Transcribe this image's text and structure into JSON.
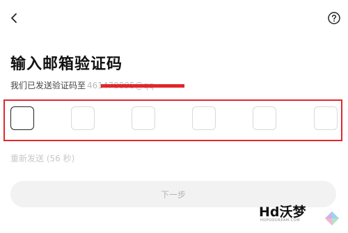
{
  "header": {
    "back_icon": "chevron-left-icon",
    "help_icon": "question-circle-icon"
  },
  "title": "输入邮箱验证码",
  "subtitle": {
    "prefix": "我们已发送验证码至",
    "email_masked": "461478895@qq"
  },
  "code_inputs": {
    "count": 6,
    "values": [
      "",
      "",
      "",
      "",
      "",
      ""
    ],
    "active_index": 0
  },
  "resend": {
    "label": "重新发送 (56 秒)"
  },
  "next_button": {
    "label": "下一步",
    "enabled": false
  },
  "watermark": {
    "text": "Hd沃梦",
    "sub": "HDPOODREAM.COM"
  },
  "colors": {
    "accent_red": "#e1262c",
    "text_primary": "#111111",
    "disabled_text": "#b4b4b4",
    "disabled_bg": "#f2f2f2"
  }
}
